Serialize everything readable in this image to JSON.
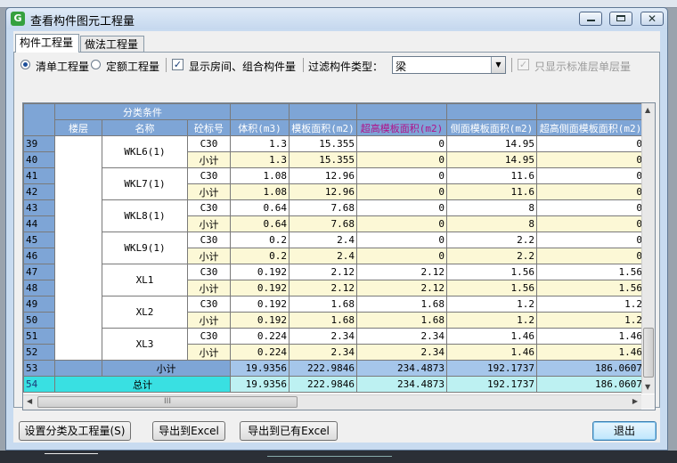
{
  "window": {
    "title": "查看构件图元工程量"
  },
  "tabs": [
    {
      "label": "构件工程量"
    },
    {
      "label": "做法工程量"
    }
  ],
  "options": {
    "radio1": "清单工程量",
    "radio2": "定额工程量",
    "show_rooms": "显示房间、组合构件量",
    "filter_label": "过滤构件类型：",
    "filter_value": "梁",
    "std_floor": "只显示标准层单层量"
  },
  "table": {
    "group_header": "分类条件",
    "columns": [
      "楼层",
      "名称",
      "砼标号",
      "体积(m3)",
      "模板面积(m2)",
      "超高模板面积(m2)",
      "侧面模板面积(m2)",
      "超高侧面模板面积(m2)"
    ],
    "rows": [
      {
        "n": "39",
        "name": "WKL6(1)",
        "c": "C30",
        "v": [
          "1.3",
          "15.355",
          "0",
          "14.95",
          "0"
        ]
      },
      {
        "n": "40",
        "c": "小计",
        "v": [
          "1.3",
          "15.355",
          "0",
          "14.95",
          "0"
        ]
      },
      {
        "n": "41",
        "name": "WKL7(1)",
        "c": "C30",
        "v": [
          "1.08",
          "12.96",
          "0",
          "11.6",
          "0"
        ]
      },
      {
        "n": "42",
        "c": "小计",
        "v": [
          "1.08",
          "12.96",
          "0",
          "11.6",
          "0"
        ]
      },
      {
        "n": "43",
        "name": "WKL8(1)",
        "c": "C30",
        "v": [
          "0.64",
          "7.68",
          "0",
          "8",
          "0"
        ]
      },
      {
        "n": "44",
        "c": "小计",
        "v": [
          "0.64",
          "7.68",
          "0",
          "8",
          "0"
        ]
      },
      {
        "n": "45",
        "name": "WKL9(1)",
        "c": "C30",
        "v": [
          "0.2",
          "2.4",
          "0",
          "2.2",
          "0"
        ]
      },
      {
        "n": "46",
        "c": "小计",
        "v": [
          "0.2",
          "2.4",
          "0",
          "2.2",
          "0"
        ]
      },
      {
        "n": "47",
        "name": "XL1",
        "c": "C30",
        "v": [
          "0.192",
          "2.12",
          "2.12",
          "1.56",
          "1.56"
        ]
      },
      {
        "n": "48",
        "c": "小计",
        "v": [
          "0.192",
          "2.12",
          "2.12",
          "1.56",
          "1.56"
        ]
      },
      {
        "n": "49",
        "name": "XL2",
        "c": "C30",
        "v": [
          "0.192",
          "1.68",
          "1.68",
          "1.2",
          "1.2"
        ]
      },
      {
        "n": "50",
        "c": "小计",
        "v": [
          "0.192",
          "1.68",
          "1.68",
          "1.2",
          "1.2"
        ]
      },
      {
        "n": "51",
        "name": "XL3",
        "c": "C30",
        "v": [
          "0.224",
          "2.34",
          "2.34",
          "1.46",
          "1.46"
        ]
      },
      {
        "n": "52",
        "c": "小计",
        "v": [
          "0.224",
          "2.34",
          "2.34",
          "1.46",
          "1.46"
        ]
      }
    ],
    "subtotal": {
      "n": "53",
      "label": "小计",
      "v": [
        "19.9356",
        "222.9846",
        "234.4873",
        "192.1737",
        "186.0607"
      ]
    },
    "total": {
      "n": "54",
      "label": "总计",
      "v": [
        "19.9356",
        "222.9846",
        "234.4873",
        "192.1737",
        "186.0607"
      ]
    }
  },
  "buttons": {
    "settings": "设置分类及工程量(S)",
    "export": "导出到Excel",
    "export_existing": "导出到已有Excel",
    "exit": "退出"
  }
}
